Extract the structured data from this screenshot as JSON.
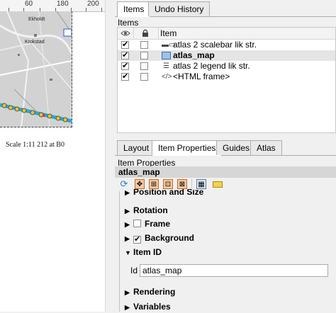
{
  "ruler": {
    "ticks": [
      "60",
      "180",
      "200"
    ]
  },
  "map": {
    "places": [
      "Ekholdt",
      "Krokstad"
    ]
  },
  "scale_text": "Scale 1:11 212 at B0",
  "top_tabs": [
    {
      "label": "Items",
      "active": true
    },
    {
      "label": "Undo History",
      "active": false
    }
  ],
  "items_panel": {
    "label": "Items",
    "columns": {
      "visible": "eye-icon",
      "locked": "lock-icon",
      "item": "Item"
    },
    "rows": [
      {
        "label": "atlas 2 scalebar lik str.",
        "visible": true,
        "icon": "scalebar-icon",
        "selected": false
      },
      {
        "label": "atlas_map",
        "visible": true,
        "icon": "map-icon",
        "selected": true
      },
      {
        "label": "atlas 2 legend lik str.",
        "visible": true,
        "icon": "legend-icon",
        "selected": false
      },
      {
        "label": "<HTML frame>",
        "visible": true,
        "icon": "html-frame-icon",
        "selected": false
      }
    ]
  },
  "bottom_tabs": [
    {
      "label": "Layout",
      "active": false
    },
    {
      "label": "Item Properties",
      "active": true
    },
    {
      "label": "Guides",
      "active": false
    },
    {
      "label": "Atlas",
      "active": false
    }
  ],
  "item_properties": {
    "label": "Item Properties",
    "title": "atlas_map",
    "toolbar": [
      "refresh-icon",
      "move-content-icon",
      "set-extent-icon",
      "view-extent-icon",
      "zoom-extent-icon",
      "label-icon"
    ],
    "sections": {
      "position": "Position and Size",
      "rotation": "Rotation",
      "frame": "Frame",
      "background": "Background",
      "item_id": "Item ID",
      "rendering": "Rendering",
      "variables": "Variables"
    },
    "frame_checked": false,
    "background_checked": true,
    "id_label": "Id",
    "id_value": "atlas_map"
  },
  "colors": {
    "selected_row": "#e5e5e5",
    "section_header": "#d6d6d6"
  }
}
